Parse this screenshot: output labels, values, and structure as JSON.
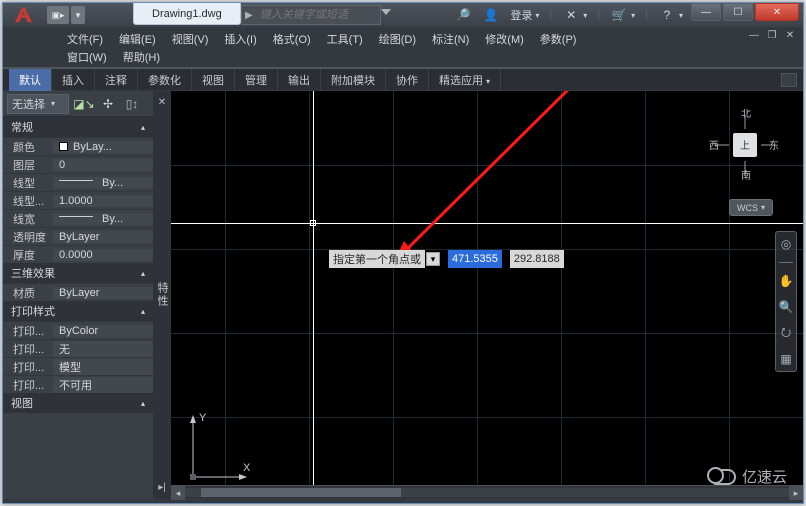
{
  "title": {
    "document": "Drawing1.dwg"
  },
  "search": {
    "placeholder": "键入关键字或短语"
  },
  "account": {
    "login_label": "登录"
  },
  "menus": {
    "row1": [
      "文件(F)",
      "编辑(E)",
      "视图(V)",
      "插入(I)",
      "格式(O)",
      "工具(T)",
      "绘图(D)",
      "标注(N)",
      "修改(M)",
      "参数(P)"
    ],
    "row2": [
      "窗口(W)",
      "帮助(H)"
    ]
  },
  "ribbon": {
    "tabs": [
      "默认",
      "插入",
      "注释",
      "参数化",
      "视图",
      "管理",
      "输出",
      "附加模块",
      "协作",
      "精选应用"
    ],
    "active_index": 0
  },
  "palette": {
    "title": "特性",
    "selector": "无选择",
    "sections": [
      {
        "title": "常规",
        "rows": [
          {
            "name": "颜色",
            "value": "ByLay...",
            "swatch": true
          },
          {
            "name": "图层",
            "value": "0"
          },
          {
            "name": "线型",
            "value": "By...",
            "linetype": true
          },
          {
            "name": "线型...",
            "value": "1.0000"
          },
          {
            "name": "线宽",
            "value": "By...",
            "linetype": true
          },
          {
            "name": "透明度",
            "value": "ByLayer"
          },
          {
            "name": "厚度",
            "value": "0.0000"
          }
        ]
      },
      {
        "title": "三维效果",
        "rows": [
          {
            "name": "材质",
            "value": "ByLayer"
          }
        ]
      },
      {
        "title": "打印样式",
        "rows": [
          {
            "name": "打印...",
            "value": "ByColor"
          },
          {
            "name": "打印...",
            "value": "无"
          },
          {
            "name": "打印...",
            "value": "模型"
          },
          {
            "name": "打印...",
            "value": "不可用"
          }
        ]
      },
      {
        "title": "视图",
        "rows": []
      }
    ]
  },
  "dynamic_input": {
    "prompt": "指定第一个角点或",
    "x": "471.5355",
    "y": "292.8188"
  },
  "ucs": {
    "x": "X",
    "y": "Y"
  },
  "viewcube": {
    "n": "北",
    "s": "南",
    "e": "东",
    "w": "西",
    "face": "上",
    "wcs": "WCS"
  },
  "watermark_text": "亿速云"
}
